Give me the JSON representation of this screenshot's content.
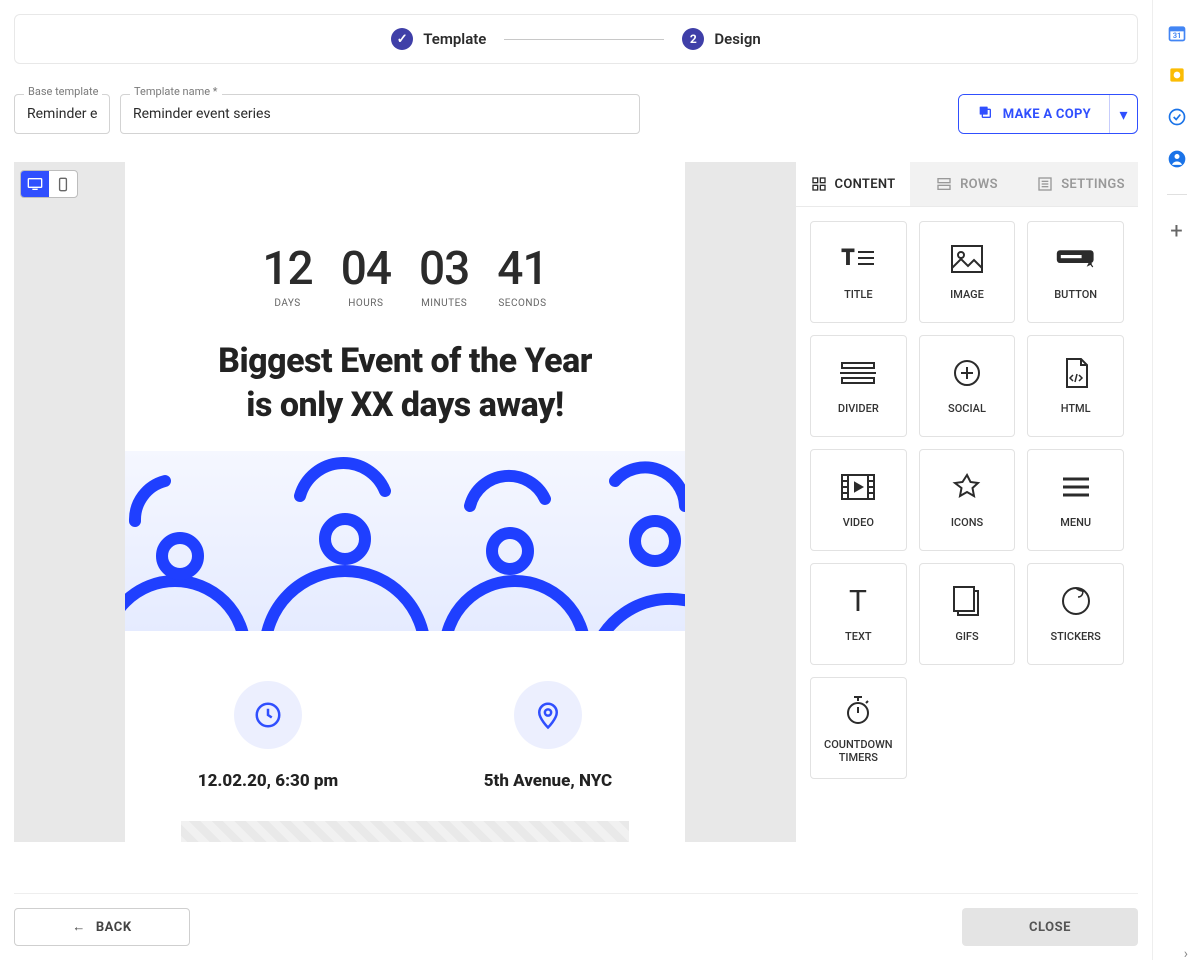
{
  "stepper": {
    "step1_label": "Template",
    "step2_label": "Design",
    "step2_num": "2"
  },
  "fields": {
    "base_label": "Base template",
    "base_value": "Reminder ev",
    "name_label": "Template name *",
    "name_value": "Reminder event series"
  },
  "copy": {
    "label": "MAKE A COPY"
  },
  "tabs": {
    "content": "CONTENT",
    "rows": "ROWS",
    "settings": "SETTINGS"
  },
  "elements": [
    "TITLE",
    "IMAGE",
    "BUTTON",
    "DIVIDER",
    "SOCIAL",
    "HTML",
    "VIDEO",
    "ICONS",
    "MENU",
    "TEXT",
    "GIFS",
    "STICKERS",
    "COUNTDOWN\nTIMERS"
  ],
  "countdown": {
    "days_num": "12",
    "days_lbl": "DAYS",
    "hours_num": "04",
    "hours_lbl": "HOURS",
    "minutes_num": "03",
    "minutes_lbl": "MINUTES",
    "seconds_num": "41",
    "seconds_lbl": "SECONDS"
  },
  "hero": {
    "line1": "Biggest Event of the Year",
    "line2": "is only XX days away!"
  },
  "info": {
    "datetime": "12.02.20, 6:30 pm",
    "location": "5th Avenue, NYC"
  },
  "footer": {
    "back": "BACK",
    "close": "CLOSE"
  },
  "colors": {
    "primary": "#304ffe"
  }
}
